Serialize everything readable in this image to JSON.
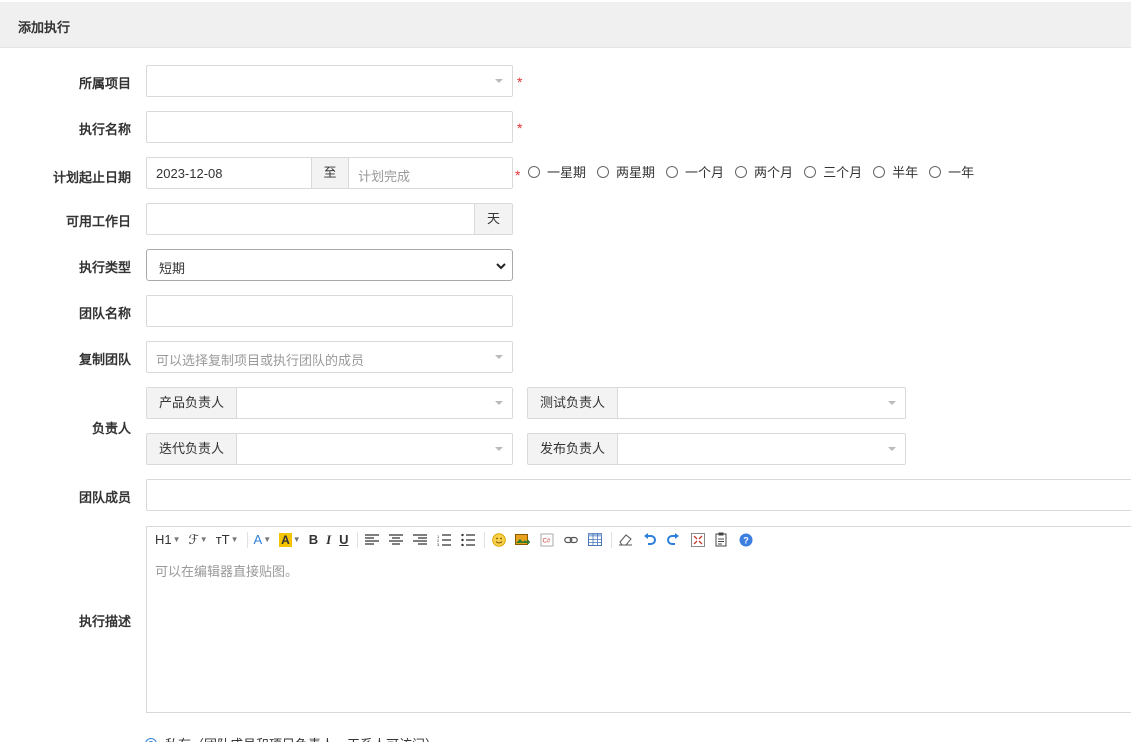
{
  "header": {
    "title": "添加执行"
  },
  "form": {
    "project": {
      "label": "所属项目",
      "value": "",
      "required_mark": "*"
    },
    "name": {
      "label": "执行名称",
      "value": "",
      "required_mark": "*"
    },
    "dates": {
      "label": "计划起止日期",
      "start": "2023-12-08",
      "separator": "至",
      "end_placeholder": "计划完成",
      "required_mark": "*",
      "quick_options": [
        "一星期",
        "两星期",
        "一个月",
        "两个月",
        "三个月",
        "半年",
        "一年"
      ]
    },
    "workdays": {
      "label": "可用工作日",
      "value": "",
      "unit": "天"
    },
    "type": {
      "label": "执行类型",
      "value": "短期"
    },
    "team_name": {
      "label": "团队名称",
      "value": ""
    },
    "copy_team": {
      "label": "复制团队",
      "placeholder": "可以选择复制项目或执行团队的成员"
    },
    "owners": {
      "label": "负责人",
      "product_owner": "产品负责人",
      "test_owner": "测试负责人",
      "iteration_owner": "迭代负责人",
      "release_owner": "发布负责人"
    },
    "members": {
      "label": "团队成员",
      "value": ""
    },
    "description": {
      "label": "执行描述",
      "placeholder": "可以在编辑器直接贴图。",
      "toolbar": {
        "heading": "H1",
        "font": "ℱ",
        "size": "ᴛT",
        "font_color": "A",
        "bg_color": "A",
        "bold": "B",
        "italic": "I",
        "underline": "U"
      }
    },
    "access": {
      "label": "私有（团队成员和项目负责人、干系人可访问）"
    }
  },
  "colors": {
    "required": "#e53333",
    "border": "#d9d9d9",
    "addon_bg": "#f3f3f3",
    "header_bg": "#f0f0f0",
    "accent": "#2e7fd9"
  }
}
